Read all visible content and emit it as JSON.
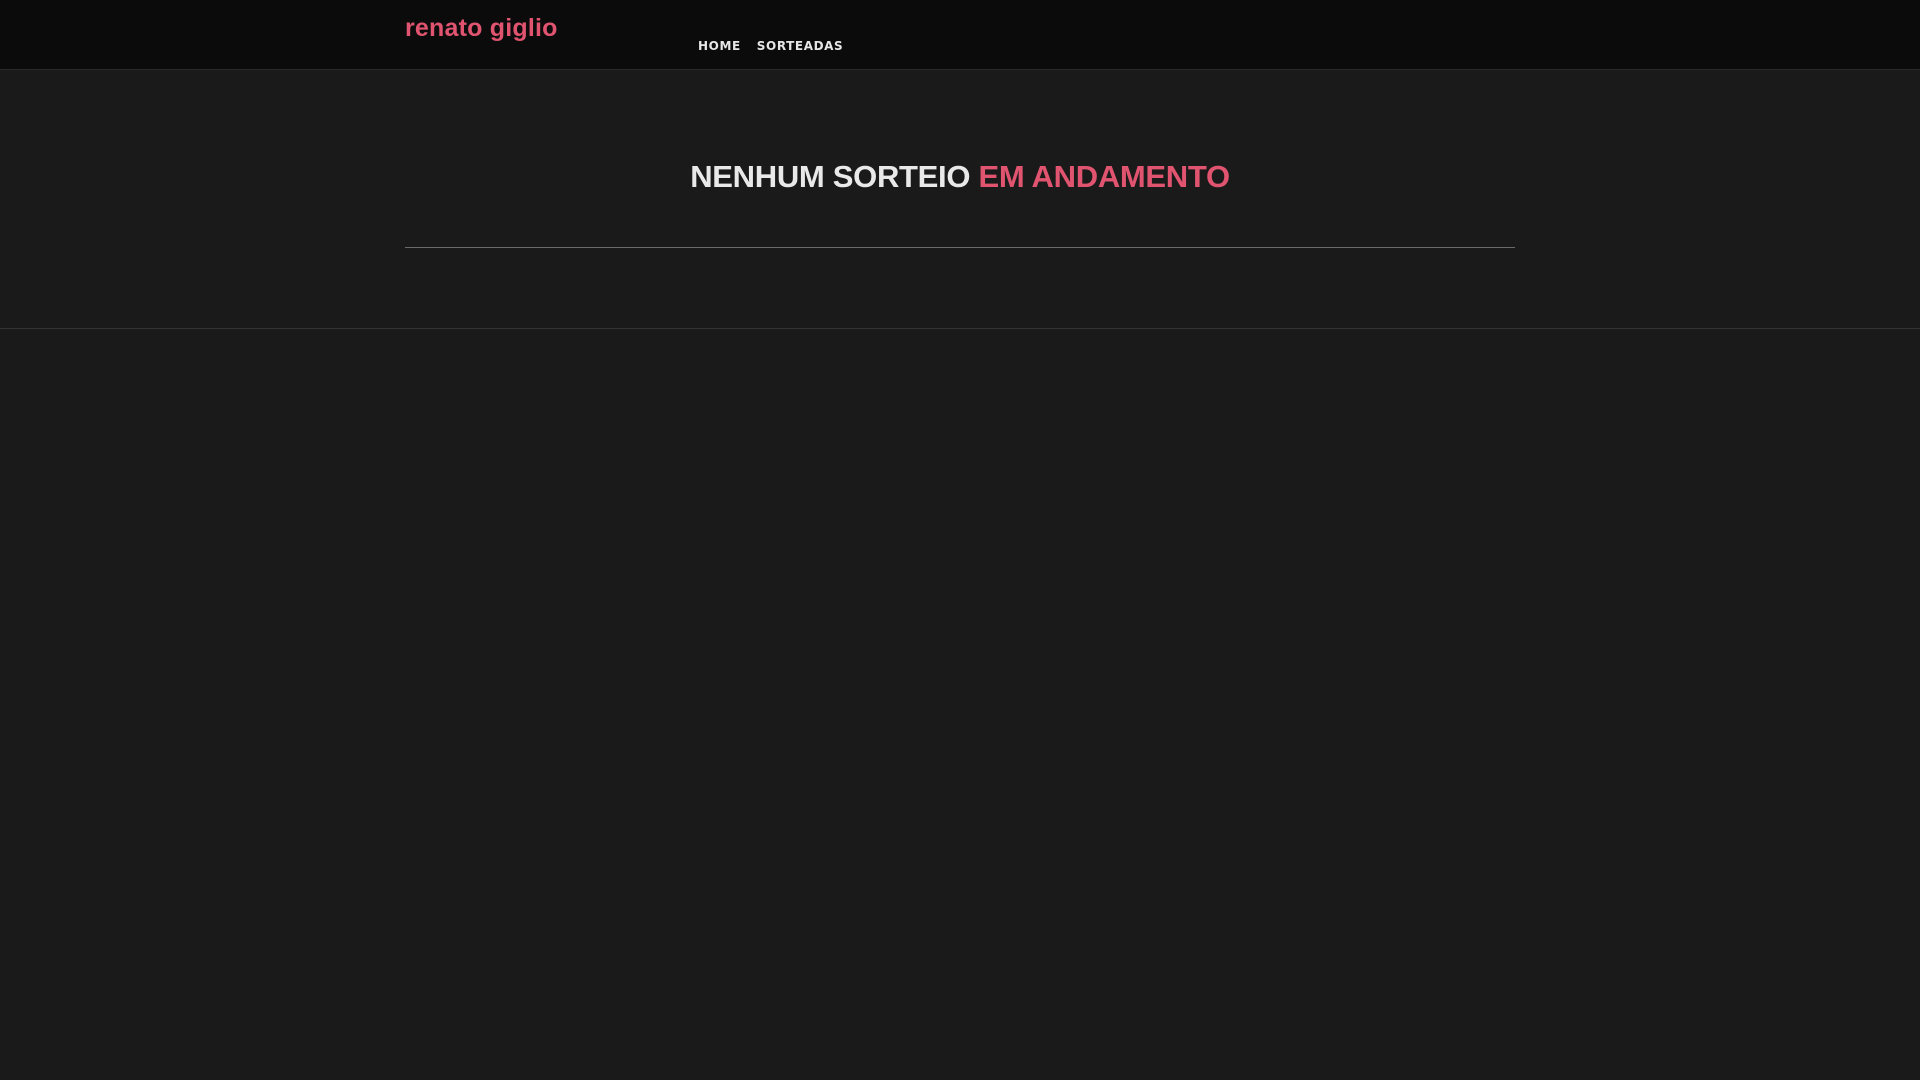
{
  "header": {
    "brand": "renato giglio",
    "nav": [
      {
        "label": "HOME"
      },
      {
        "label": "SORTEADAS"
      }
    ]
  },
  "main": {
    "title_part1": "NENHUM SORTEIO",
    "title_part2": "EM ANDAMENTO"
  },
  "colors": {
    "accent": "#e05470",
    "title_primary": "#e9e9e9",
    "background": "#1a1a1a",
    "header_background": "#0b0b0b"
  }
}
